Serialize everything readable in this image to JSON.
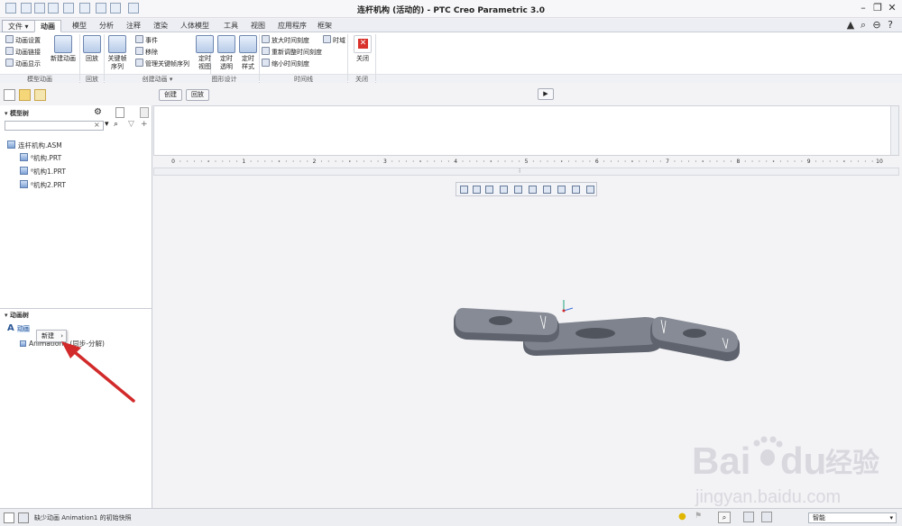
{
  "window": {
    "title": "连杆机构 (活动的) - PTC Creo Parametric 3.0"
  },
  "tabs": [
    {
      "label": "文件 ▾"
    },
    {
      "label": "动画"
    },
    {
      "label": "模型"
    },
    {
      "label": "分析"
    },
    {
      "label": "注释"
    },
    {
      "label": "渲染"
    },
    {
      "label": "人体模型"
    },
    {
      "label": "工具"
    },
    {
      "label": "视图"
    },
    {
      "label": "应用程序"
    },
    {
      "label": "框架"
    }
  ],
  "ribbon": {
    "model_anim": {
      "items": [
        "动画设置",
        "动画链接",
        "动画显示"
      ],
      "new_anim": "新建动画",
      "label": "模型动画"
    },
    "playback": {
      "btn": "回放",
      "label": "回放"
    },
    "create": {
      "keyframe": "关键帧\n序列",
      "event": "事件",
      "remove": "移除",
      "manage": "管理关键帧序列",
      "label": "创建动画 ▾"
    },
    "graph": {
      "b1": "定时\n视图",
      "b2": "定时\n透明",
      "b3": "定时\n样式",
      "label": "图形设计"
    },
    "timeline": {
      "zoom_in": "放大时间刻度",
      "rescale": "重新调整时间刻度",
      "zoom_out": "缩小时间刻度",
      "timefield": "时域",
      "label": "时间线"
    },
    "close": {
      "btn": "关闭",
      "label": "关闭"
    }
  },
  "toolbar2": {
    "create": "创建",
    "playback": "回放"
  },
  "model_tree": {
    "header": "模型树",
    "search_placeholder": "",
    "items": [
      "连杆机构.ASM",
      "⁸机构.PRT",
      "⁸机构1.PRT",
      "⁸机构2.PRT"
    ]
  },
  "anim_tree": {
    "header": "动画树",
    "root": "动画",
    "child": "Animation1 (同步-分解)"
  },
  "context_menu": {
    "item": "新建",
    "arrow": "›"
  },
  "ruler": {
    "ticks": [
      "0",
      "1",
      "2",
      "3",
      "4",
      "5",
      "6",
      "7",
      "8",
      "9",
      "10"
    ]
  },
  "status": {
    "message": "缺少动画 Animation1 的初始快照",
    "smart": "智能"
  },
  "watermark": {
    "brand": "Bai",
    "brand2": "du",
    "cn": "经验",
    "url": "jingyan.baidu.com"
  },
  "colors": {
    "accent": "#2b5797",
    "arrow": "#d22a2a",
    "part": "#7a7f89"
  }
}
